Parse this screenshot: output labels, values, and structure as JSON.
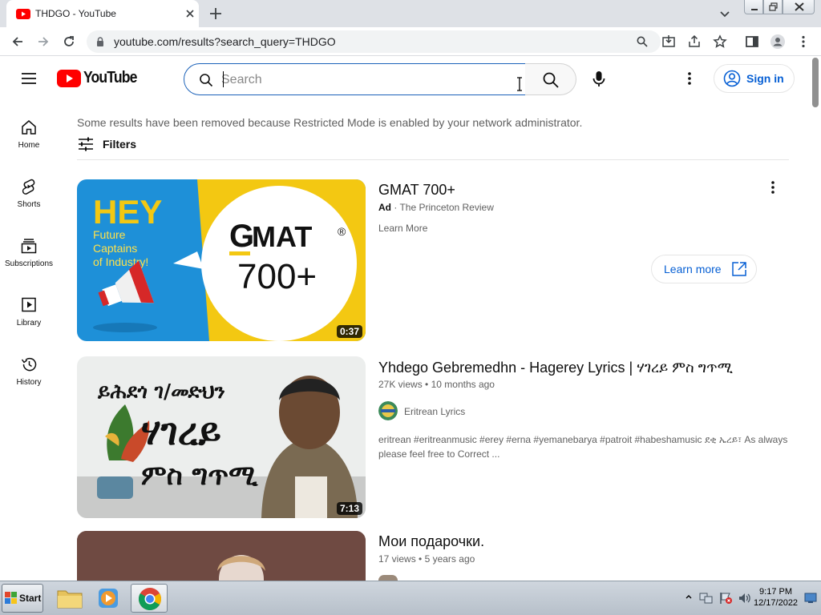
{
  "browser": {
    "tab_title": "THDGO - YouTube",
    "url": "youtube.com/results?search_query=THDGO"
  },
  "header": {
    "logo_text": "YouTube",
    "search_placeholder": "Search",
    "signin_label": "Sign in"
  },
  "sidebar": {
    "items": [
      {
        "label": "Home",
        "icon": "home-icon"
      },
      {
        "label": "Shorts",
        "icon": "shorts-icon"
      },
      {
        "label": "Subscriptions",
        "icon": "subscriptions-icon"
      },
      {
        "label": "Library",
        "icon": "library-icon"
      },
      {
        "label": "History",
        "icon": "history-icon"
      }
    ]
  },
  "main": {
    "notice": "Some results have been removed because Restricted Mode is enabled by your network administrator.",
    "filters_label": "Filters",
    "results": [
      {
        "title": "GMAT 700+",
        "ad_badge": "Ad",
        "advertiser": "The Princeton Review",
        "subtext": "Learn More",
        "duration": "0:37",
        "cta_label": "Learn more",
        "thumb_text": {
          "hey": "HEY",
          "sub": "Future Captains of Industry!",
          "g": "G",
          "mat": "MAT",
          "reg": "®",
          "num": "700+"
        }
      },
      {
        "title": "Yhdego Gebremedhn - Hagerey Lyrics | ሃገረይ ምስ ግጥሚ",
        "views": "27K views",
        "age": "10 months ago",
        "channel": "Eritrean Lyrics",
        "description": "eritrean #eritreanmusic #erey #erna #yemanebarya #patroit #habeshamusic ደቂ ኤረይ፣ As always please feel free to Correct ...",
        "duration": "7:13",
        "thumb_text": {
          "line1": "ይሕደጎ ገ/መድህን",
          "line2": "ሃገረይ",
          "line3": "ምስ ግጥሚ"
        }
      },
      {
        "title": "Мои подарочки.",
        "views": "17 views",
        "age": "5 years ago"
      }
    ]
  },
  "taskbar": {
    "start_label": "Start",
    "time": "9:17 PM",
    "date": "12/17/2022"
  },
  "colors": {
    "yt_red": "#ff0000",
    "link_blue": "#065fd4",
    "gmat_yellow": "#f3c812",
    "gmat_blue": "#1e90d8"
  }
}
